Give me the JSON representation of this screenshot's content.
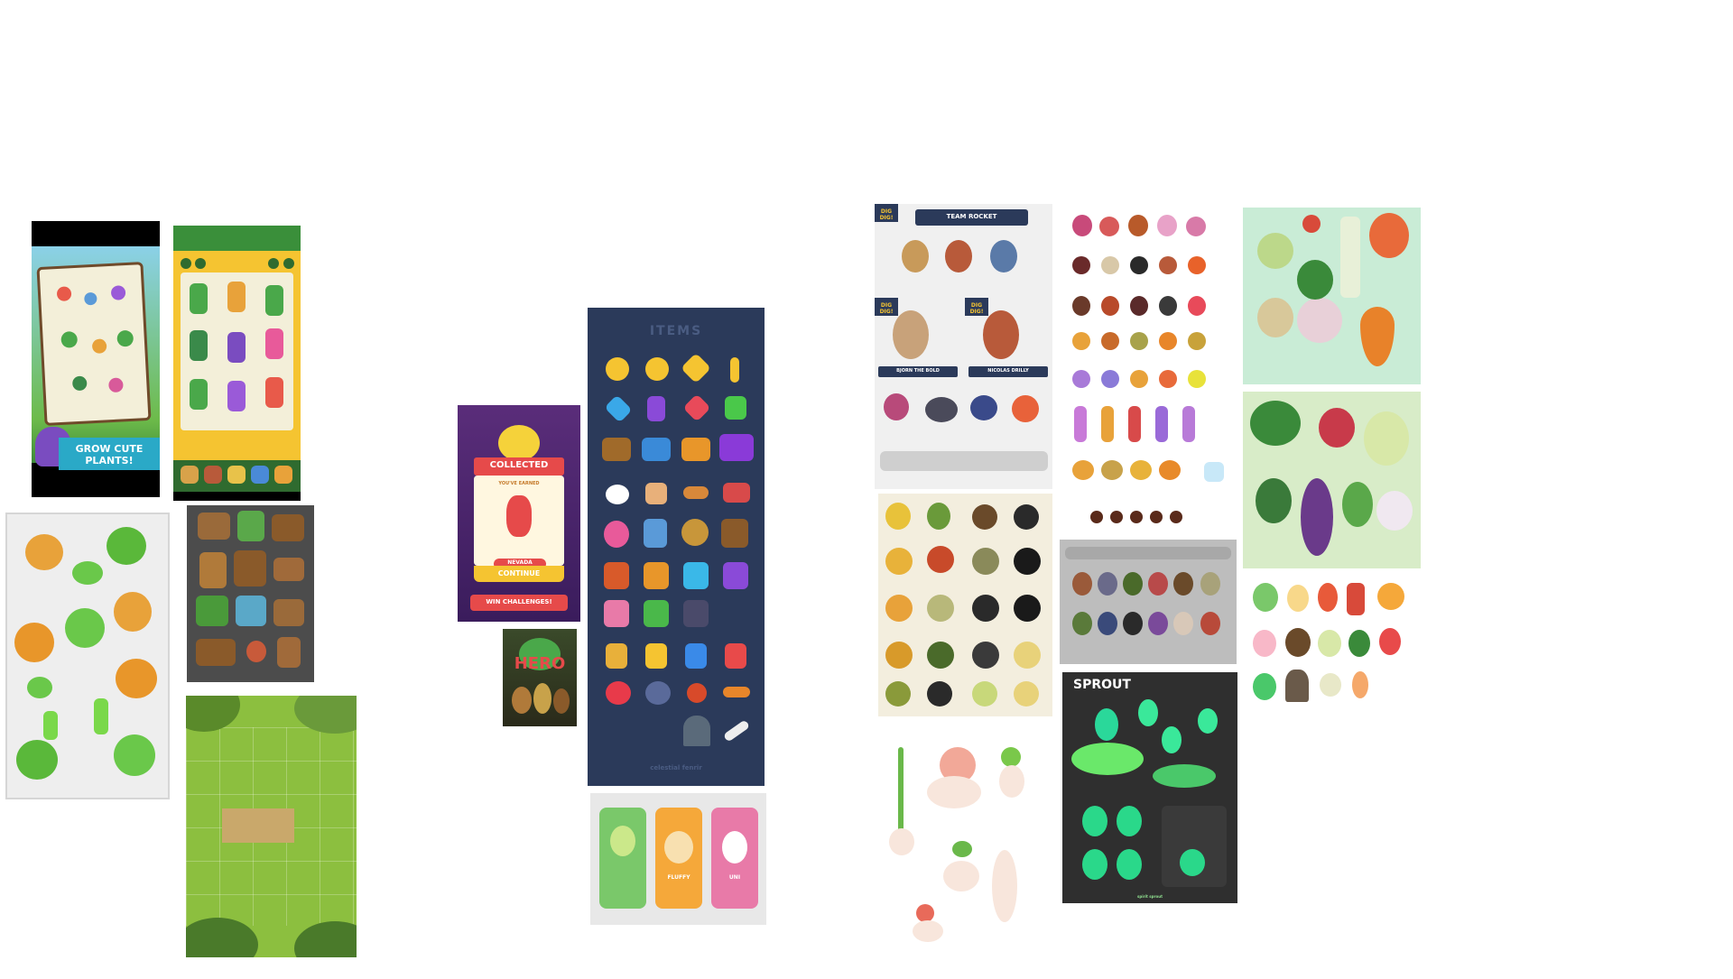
{
  "board": {
    "phone_grow": {
      "banner": "GROW CUTE PLANTS!"
    },
    "collected_popup": {
      "ribbon": "COLLECTED",
      "earned": "YOU'VE EARNED",
      "badge": "NEVADA",
      "continue": "CONTINUE",
      "win": "WIN CHALLENGES!"
    },
    "hero_thumb": {
      "logo": "HERO"
    },
    "items_sheet": {
      "title": "ITEMS",
      "credit": "celestial fenrir"
    },
    "pet_app": {
      "cards": [
        "",
        "FLUFFY",
        "UNI"
      ]
    },
    "dig_dig": {
      "logos": [
        "DIG DIG!",
        "DIG DIG!",
        "DIG DIG!"
      ],
      "header": "TEAM ROCKET",
      "captions": [
        "BJORN THE BOLD",
        "NICOLAS DRILLY"
      ]
    },
    "sprout": {
      "title": "SPROUT",
      "credit": "spirit sprout"
    },
    "colors": {
      "items_bg": "#2b3a5a",
      "popup_red": "#e64a4a",
      "accent_yellow": "#f5c431",
      "leaf_green": "#6dbb4a"
    }
  }
}
